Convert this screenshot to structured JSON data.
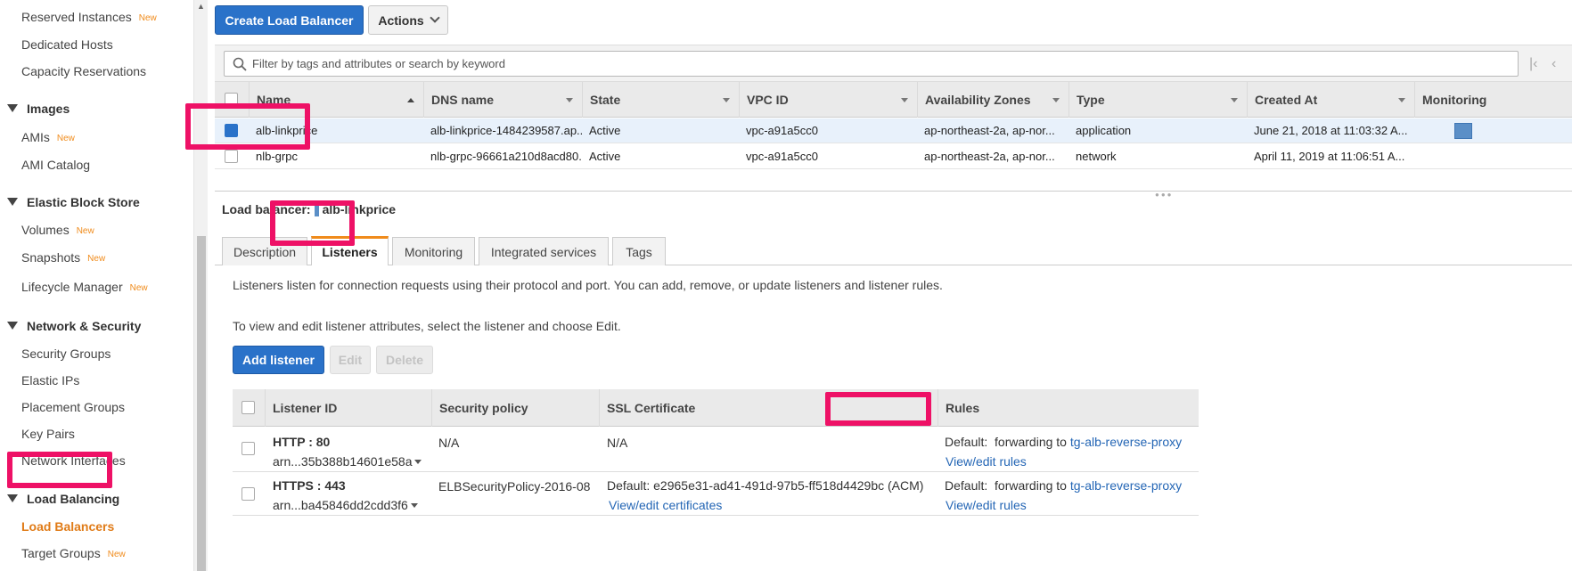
{
  "sidebar": {
    "sections": [
      {
        "title": "Images"
      },
      {
        "title": "Elastic Block Store"
      },
      {
        "title": "Network & Security"
      },
      {
        "title": "Load Balancing"
      }
    ],
    "items": [
      {
        "label": "Reserved Instances",
        "new": "New"
      },
      {
        "label": "Dedicated Hosts"
      },
      {
        "label": "Capacity Reservations"
      },
      {
        "label": "AMIs",
        "new": "New"
      },
      {
        "label": "AMI Catalog"
      },
      {
        "label": "Volumes",
        "new": "New"
      },
      {
        "label": "Snapshots",
        "new": "New"
      },
      {
        "label": "Lifecycle Manager",
        "new": "New"
      },
      {
        "label": "Security Groups"
      },
      {
        "label": "Elastic IPs"
      },
      {
        "label": "Placement Groups"
      },
      {
        "label": "Key Pairs"
      },
      {
        "label": "Network Interfaces"
      },
      {
        "label": "Load Balancers"
      },
      {
        "label": "Target Groups",
        "new": "New"
      }
    ]
  },
  "toolbar": {
    "create_label": "Create Load Balancer",
    "actions_label": "Actions"
  },
  "filter": {
    "placeholder": "Filter by tags and attributes or search by keyword"
  },
  "lb_table": {
    "columns": [
      "Name",
      "DNS name",
      "State",
      "VPC ID",
      "Availability Zones",
      "Type",
      "Created At",
      "Monitoring"
    ],
    "rows": [
      {
        "name": "alb-linkprice",
        "dns": "alb-linkprice-1484239587.ap...",
        "state": "Active",
        "vpc": "vpc-a91a5cc0",
        "az": "ap-northeast-2a, ap-nor...",
        "type": "application",
        "created": "June 21, 2018 at 11:03:32 A..."
      },
      {
        "name": "nlb-grpc",
        "dns": "nlb-grpc-96661a210d8acd80...",
        "state": "Active",
        "vpc": "vpc-a91a5cc0",
        "az": "ap-northeast-2a, ap-nor...",
        "type": "network",
        "created": "April 11, 2019 at 11:06:51 A..."
      }
    ]
  },
  "detail": {
    "label": "Load balancer:",
    "name": "alb-linkprice",
    "tabs": [
      "Description",
      "Listeners",
      "Monitoring",
      "Integrated services",
      "Tags"
    ],
    "desc1": "Listeners listen for connection requests using their protocol and port. You can add, remove, or update listeners and listener rules.",
    "desc2": "To view and edit listener attributes, select the listener and choose Edit.",
    "add_label": "Add listener",
    "edit_label": "Edit",
    "delete_label": "Delete"
  },
  "listener_table": {
    "columns": [
      "Listener ID",
      "Security policy",
      "SSL Certificate",
      "Rules"
    ],
    "rows": [
      {
        "id": "HTTP : 80",
        "arn": "arn...35b388b14601e58a",
        "policy": "N/A",
        "cert": "N/A",
        "cert_link": "",
        "rule_default": "Default:",
        "rule_forward": "forwarding to",
        "rule_target": "tg-alb-reverse-proxy",
        "rule_link": "View/edit rules"
      },
      {
        "id": "HTTPS : 443",
        "arn": "arn...ba45846dd2cdd3f6",
        "policy": "ELBSecurityPolicy-2016-08",
        "cert": "Default:   e2965e31-ad41-491d-97b5-ff518d4429bc (ACM)",
        "cert_link": "View/edit certificates",
        "rule_default": "Default:",
        "rule_forward": "forwarding to",
        "rule_target": "tg-alb-reverse-proxy",
        "rule_link": "View/edit rules"
      }
    ]
  },
  "colors": {
    "accent": "#2a72c9",
    "highlight": "#ee1166",
    "active_nav": "#e07b17",
    "new_badge": "#f08b1b"
  }
}
